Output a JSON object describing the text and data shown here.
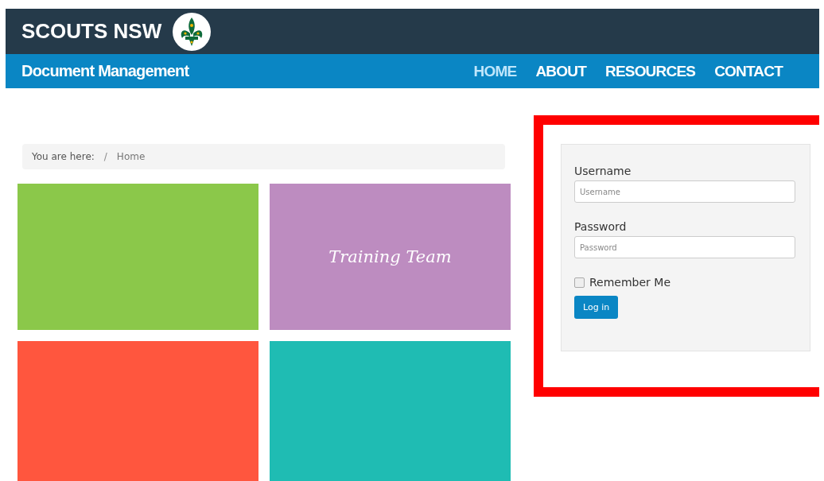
{
  "header": {
    "title": "SCOUTS NSW",
    "subtitle": "Document Management"
  },
  "nav": [
    {
      "label": "HOME",
      "selected": true
    },
    {
      "label": "ABOUT",
      "selected": false
    },
    {
      "label": "RESOURCES",
      "selected": false
    },
    {
      "label": "CONTACT",
      "selected": false
    }
  ],
  "breadcrumb": {
    "label": "You are here:",
    "separator": "/",
    "items": [
      "Home"
    ]
  },
  "tiles": [
    {
      "color": "#8bc84a"
    },
    {
      "color": "#bd8cc0",
      "label": "Training Team"
    },
    {
      "color": "#ff563e"
    },
    {
      "color": "#1fbcb3"
    }
  ],
  "login": {
    "fields": [
      {
        "label": "Username",
        "placeholder": "Username"
      },
      {
        "label": "Password",
        "placeholder": "Password"
      }
    ],
    "remember": {
      "label": "Remember Me",
      "checked": false
    },
    "button": "Log in"
  }
}
